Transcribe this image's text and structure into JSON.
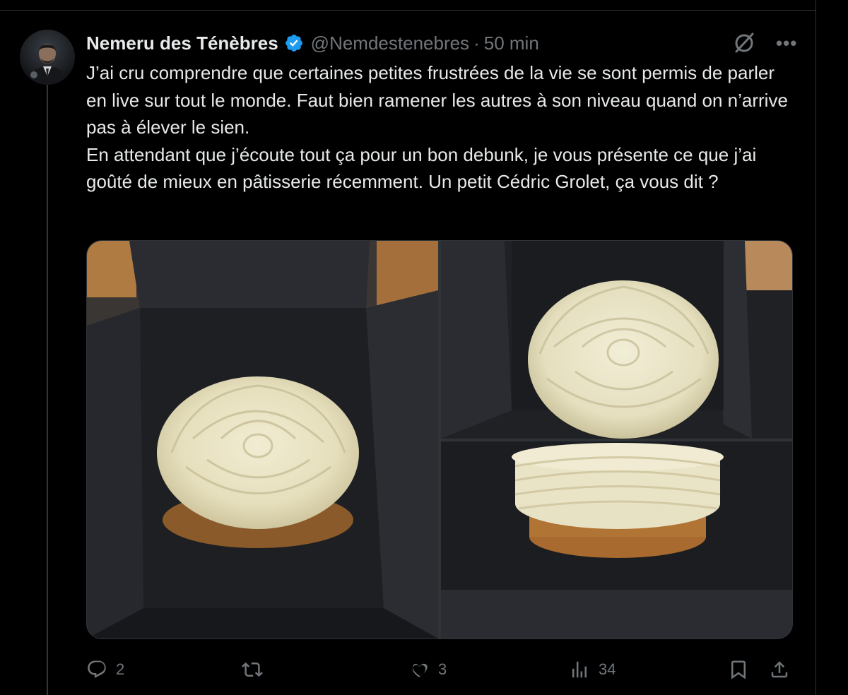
{
  "tweet": {
    "author": {
      "display_name": "Nemeru des Ténèbres",
      "handle": "@Nemdestenebres",
      "verified": true,
      "verified_color": "#1d9bf0"
    },
    "separator": "·",
    "time": "50 min",
    "text": "J’ai cru comprendre que certaines petites frustrées de la vie se sont permis de parler en live sur tout le monde. Faut bien ramener les autres à son niveau quand on n’arrive pas à élever le sien.\nEn attendant que j’écoute tout ça pour un bon debunk, je vous présente ce que j’ai goûté de mieux en pâtisserie récemment. Un petit Cédric Grolet, ça vous dit ?",
    "media": [
      {
        "kind": "photo",
        "subject": "pastry-in-box-top-view"
      },
      {
        "kind": "photo",
        "subject": "pastry-in-box-close-up"
      },
      {
        "kind": "photo",
        "subject": "pastry-side-view"
      }
    ],
    "header_icons": [
      "grok-icon",
      "more-icon"
    ],
    "actions": {
      "reply": {
        "icon": "reply-icon",
        "count": "2"
      },
      "retweet": {
        "icon": "retweet-icon",
        "count": ""
      },
      "like": {
        "icon": "heart-icon",
        "count": "3"
      },
      "views": {
        "icon": "views-icon",
        "count": "34"
      },
      "bookmark": {
        "icon": "bookmark-icon"
      },
      "share": {
        "icon": "share-icon"
      }
    }
  },
  "colors": {
    "background": "#000000",
    "text": "#e7e9ea",
    "muted": "#71767b",
    "border": "#2f3336"
  }
}
